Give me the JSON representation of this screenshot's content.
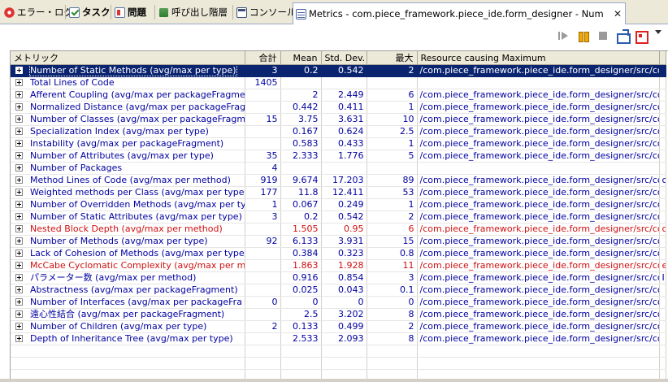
{
  "tabs": [
    {
      "label": "エラー・ログ",
      "icon": "error-log-icon"
    },
    {
      "label": "タスク",
      "icon": "task-icon"
    },
    {
      "label": "問題",
      "icon": "problems-icon"
    },
    {
      "label": "呼び出し階層",
      "icon": "call-hierarchy-icon"
    },
    {
      "label": "コンソール",
      "icon": "console-icon"
    },
    {
      "label": "Metrics - com.piece_framework.piece_ide.form_designer - Number of S",
      "icon": "metrics-icon"
    }
  ],
  "columns": [
    "メトリック",
    "合計",
    "Mean",
    "Std. Dev.",
    "最大",
    "Resource causing Maximum"
  ],
  "rows": [
    {
      "name": "Number of Static Methods (avg/max per type)",
      "total": "3",
      "mean": "0.2",
      "std": "0.542",
      "max": "2",
      "resource": "/com.piece_framework.piece_ide.form_designer/src/com...",
      "extra": "",
      "status": "selected"
    },
    {
      "name": "Total Lines of Code",
      "total": "1405",
      "mean": "",
      "std": "",
      "max": "",
      "resource": "",
      "extra": "",
      "status": "normal"
    },
    {
      "name": "Afferent Coupling (avg/max per packageFragme",
      "total": "",
      "mean": "2",
      "std": "2.449",
      "max": "6",
      "resource": "/com.piece_framework.piece_ide.form_designer/src/com...",
      "extra": "",
      "status": "normal"
    },
    {
      "name": "Normalized Distance (avg/max per packageFragm",
      "total": "",
      "mean": "0.442",
      "std": "0.411",
      "max": "1",
      "resource": "/com.piece_framework.piece_ide.form_designer/src/com...",
      "extra": "",
      "status": "normal"
    },
    {
      "name": "Number of Classes (avg/max per packageFragm",
      "total": "15",
      "mean": "3.75",
      "std": "3.631",
      "max": "10",
      "resource": "/com.piece_framework.piece_ide.form_designer/src/com...",
      "extra": "",
      "status": "normal"
    },
    {
      "name": "Specialization Index (avg/max per type)",
      "total": "",
      "mean": "0.167",
      "std": "0.624",
      "max": "2.5",
      "resource": "/com.piece_framework.piece_ide.form_designer/src/com...",
      "extra": "",
      "status": "normal"
    },
    {
      "name": "Instability (avg/max per packageFragment)",
      "total": "",
      "mean": "0.583",
      "std": "0.433",
      "max": "1",
      "resource": "/com.piece_framework.piece_ide.form_designer/src/com...",
      "extra": "",
      "status": "normal"
    },
    {
      "name": "Number of Attributes (avg/max per type)",
      "total": "35",
      "mean": "2.333",
      "std": "1.776",
      "max": "5",
      "resource": "/com.piece_framework.piece_ide.form_designer/src/com...",
      "extra": "",
      "status": "normal"
    },
    {
      "name": "Number of Packages",
      "total": "4",
      "mean": "",
      "std": "",
      "max": "",
      "resource": "",
      "extra": "",
      "status": "normal"
    },
    {
      "name": "Method Lines of Code (avg/max per method)",
      "total": "919",
      "mean": "9.674",
      "std": "17.203",
      "max": "89",
      "resource": "/com.piece_framework.piece_ide.form_designer/src/com...",
      "extra": "c",
      "status": "normal"
    },
    {
      "name": "Weighted methods per Class (avg/max per type",
      "total": "177",
      "mean": "11.8",
      "std": "12.411",
      "max": "53",
      "resource": "/com.piece_framework.piece_ide.form_designer/src/com...",
      "extra": "",
      "status": "normal"
    },
    {
      "name": "Number of Overridden Methods (avg/max per ty",
      "total": "1",
      "mean": "0.067",
      "std": "0.249",
      "max": "1",
      "resource": "/com.piece_framework.piece_ide.form_designer/src/com...",
      "extra": "",
      "status": "normal"
    },
    {
      "name": "Number of Static Attributes (avg/max per type)",
      "total": "3",
      "mean": "0.2",
      "std": "0.542",
      "max": "2",
      "resource": "/com.piece_framework.piece_ide.form_designer/src/com...",
      "extra": "",
      "status": "normal"
    },
    {
      "name": "Nested Block Depth (avg/max per method)",
      "total": "",
      "mean": "1.505",
      "std": "0.95",
      "max": "6",
      "resource": "/com.piece_framework.piece_ide.form_designer/src/com...",
      "extra": "c",
      "status": "warn"
    },
    {
      "name": "Number of Methods (avg/max per type)",
      "total": "92",
      "mean": "6.133",
      "std": "3.931",
      "max": "15",
      "resource": "/com.piece_framework.piece_ide.form_designer/src/com...",
      "extra": "",
      "status": "normal"
    },
    {
      "name": "Lack of Cohesion of Methods (avg/max per type",
      "total": "",
      "mean": "0.384",
      "std": "0.323",
      "max": "0.8",
      "resource": "/com.piece_framework.piece_ide.form_designer/src/com...",
      "extra": "",
      "status": "normal"
    },
    {
      "name": "McCabe Cyclomatic Complexity (avg/max per m",
      "total": "",
      "mean": "1.863",
      "std": "1.928",
      "max": "11",
      "resource": "/com.piece_framework.piece_ide.form_designer/src/com...",
      "extra": "e",
      "status": "warn"
    },
    {
      "name": "パラメーター数 (avg/max per method)",
      "total": "",
      "mean": "0.916",
      "std": "0.854",
      "max": "3",
      "resource": "/com.piece_framework.piece_ide.form_designer/src/com...",
      "extra": "I",
      "status": "normal"
    },
    {
      "name": "Abstractness (avg/max per packageFragment)",
      "total": "",
      "mean": "0.025",
      "std": "0.043",
      "max": "0.1",
      "resource": "/com.piece_framework.piece_ide.form_designer/src/com...",
      "extra": "",
      "status": "normal"
    },
    {
      "name": "Number of Interfaces (avg/max per packageFra",
      "total": "0",
      "mean": "0",
      "std": "0",
      "max": "0",
      "resource": "/com.piece_framework.piece_ide.form_designer/src/com...",
      "extra": "",
      "status": "normal"
    },
    {
      "name": "遠心性結合 (avg/max per packageFragment)",
      "total": "",
      "mean": "2.5",
      "std": "3.202",
      "max": "8",
      "resource": "/com.piece_framework.piece_ide.form_designer/src/com...",
      "extra": "",
      "status": "normal"
    },
    {
      "name": "Number of Children (avg/max per type)",
      "total": "2",
      "mean": "0.133",
      "std": "0.499",
      "max": "2",
      "resource": "/com.piece_framework.piece_ide.form_designer/src/com...",
      "extra": "",
      "status": "normal"
    },
    {
      "name": "Depth of Inheritance Tree (avg/max per type)",
      "total": "",
      "mean": "2.533",
      "std": "2.093",
      "max": "8",
      "resource": "/com.piece_framework.piece_ide.form_designer/src/com...",
      "extra": "",
      "status": "normal"
    }
  ],
  "empty_rows": 3,
  "colors": {
    "selected_bg": "#0a2470",
    "text_blue": "#0000a0",
    "text_red": "#d01010",
    "header_bg": "#ece9d8"
  }
}
